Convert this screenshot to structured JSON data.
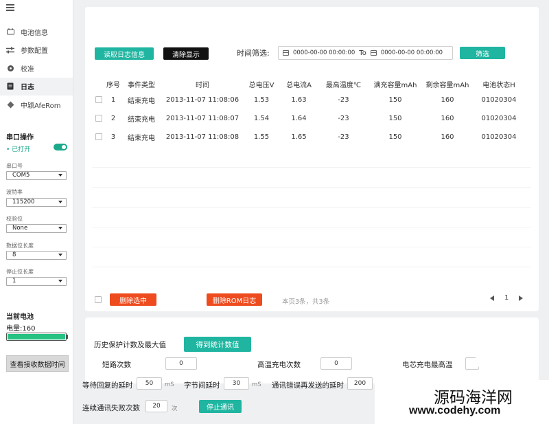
{
  "sidebar": {
    "nav": [
      {
        "label": "电池信息",
        "icon": "battery-icon",
        "active": false
      },
      {
        "label": "参数配置",
        "icon": "sliders-icon",
        "active": false
      },
      {
        "label": "校准",
        "icon": "gear-icon",
        "active": false
      },
      {
        "label": "日志",
        "icon": "document-icon",
        "active": true
      },
      {
        "label": "中颖AfeRom",
        "icon": "chip-icon",
        "active": false
      }
    ],
    "serial": {
      "title": "串口操作",
      "status": "• 已打开",
      "port_label": "串口号",
      "port_value": "COM5",
      "baud_label": "波特率",
      "baud_value": "115200",
      "parity_label": "校验位",
      "parity_value": "None",
      "databits_label": "数据位长度",
      "databits_value": "8",
      "stopbits_label": "停止位长度",
      "stopbits_value": "1"
    },
    "battery": {
      "title": "当前电池",
      "level_text": "电量:160",
      "level_fraction": 1.0
    },
    "view_time_button": "查看接收数据时间"
  },
  "toolbar": {
    "read_log": "读取日志信息",
    "clear_display": "清除显示",
    "time_filter_label": "时间筛选:",
    "start_time": "0000-00-00 00:00:00",
    "to": "To",
    "end_time": "0000-00-00 00:00:00",
    "filter": "筛选"
  },
  "table": {
    "headers": [
      "序号",
      "事件类型",
      "时间",
      "总电压V",
      "总电流A",
      "最高温度℃",
      "满充容量mAh",
      "剩余容量mAh",
      "电池状态H"
    ],
    "rows": [
      [
        "1",
        "结束充电",
        "2013-11-07 11:08:06",
        "1.53",
        "1.63",
        "-23",
        "150",
        "160",
        "01020304"
      ],
      [
        "2",
        "结束充电",
        "2013-11-07 11:08:07",
        "1.54",
        "1.64",
        "-23",
        "150",
        "160",
        "01020304"
      ],
      [
        "3",
        "结束充电",
        "2013-11-07 11:08:08",
        "1.55",
        "1.65",
        "-23",
        "150",
        "160",
        "01020304"
      ]
    ]
  },
  "footer": {
    "delete_selected": "删除选中",
    "delete_rom": "删除ROM日志",
    "page_info": "本页3条，共3条",
    "page": "1"
  },
  "history": {
    "title": "历史保护计数及最大值",
    "get_stats": "得到统计数值",
    "short_label": "短路次数",
    "short_value": "0",
    "hightemp_label": "高温充电次数",
    "hightemp_value": "0",
    "cellmax_label": "电芯充电最高温"
  },
  "comm": {
    "wait_label": "等待回复的延时",
    "wait_value": "50",
    "wait_unit": "mS",
    "byte_label": "字节间延时",
    "byte_value": "30",
    "byte_unit": "mS",
    "retry_label": "通讯错误再发送的延时",
    "retry_value": "200",
    "fail_label": "连续通讯失败次数",
    "fail_value": "20",
    "fail_unit": "次",
    "stop_button": "停止通讯"
  },
  "watermark": {
    "title": "源码海洋网",
    "url": "www.codehy.com"
  }
}
